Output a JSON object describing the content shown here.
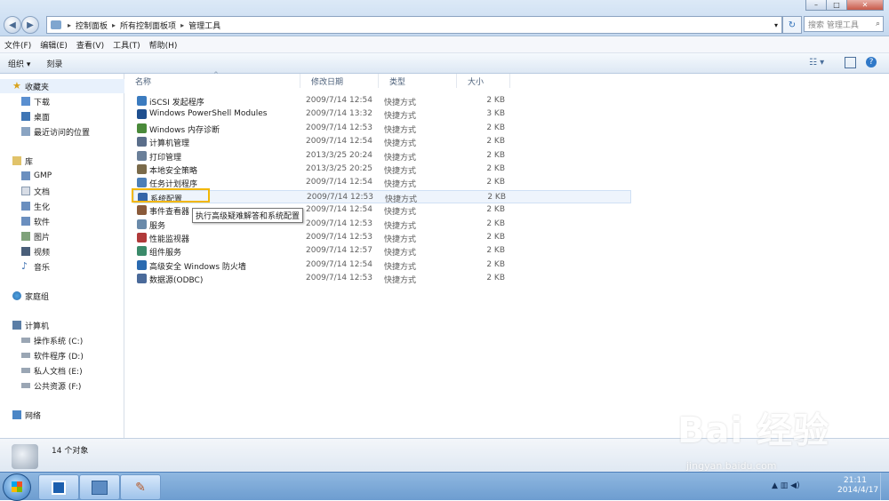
{
  "address": {
    "crumbs": [
      "控制面板",
      "所有控制面板项",
      "管理工具"
    ],
    "search_placeholder": "搜索 管理工具"
  },
  "menu": [
    "文件(F)",
    "编辑(E)",
    "查看(V)",
    "工具(T)",
    "帮助(H)"
  ],
  "toolbar": {
    "organize": "组织 ▾",
    "burn": "刻录"
  },
  "nav": {
    "favorites": {
      "label": "收藏夹",
      "items": [
        "下载",
        "桌面",
        "最近访问的位置"
      ]
    },
    "libraries": {
      "label": "库",
      "items": [
        "GMP",
        "文档",
        "生化",
        "软件",
        "图片",
        "视频",
        "音乐"
      ]
    },
    "homegroup": "家庭组",
    "computer": {
      "label": "计算机",
      "items": [
        "操作系统 (C:)",
        "软件程序 (D:)",
        "私人文档 (E:)",
        "公共资源 (F:)"
      ]
    },
    "network": "网络"
  },
  "columns": {
    "name": "名称",
    "date": "修改日期",
    "type": "类型",
    "size": "大小"
  },
  "files": [
    {
      "name": "iSCSI 发起程序",
      "date": "2009/7/14 12:54",
      "type": "快捷方式",
      "size": "2 KB",
      "color": "#3b7bbf"
    },
    {
      "name": "Windows PowerShell Modules",
      "date": "2009/7/14 13:32",
      "type": "快捷方式",
      "size": "3 KB",
      "color": "#1f4f8f"
    },
    {
      "name": "Windows 内存诊断",
      "date": "2009/7/14 12:53",
      "type": "快捷方式",
      "size": "2 KB",
      "color": "#4a8a3a"
    },
    {
      "name": "计算机管理",
      "date": "2009/7/14 12:54",
      "type": "快捷方式",
      "size": "2 KB",
      "color": "#5a6e8a"
    },
    {
      "name": "打印管理",
      "date": "2013/3/25 20:24",
      "type": "快捷方式",
      "size": "2 KB",
      "color": "#6a7f99"
    },
    {
      "name": "本地安全策略",
      "date": "2013/3/25 20:25",
      "type": "快捷方式",
      "size": "2 KB",
      "color": "#7a6a4a"
    },
    {
      "name": "任务计划程序",
      "date": "2009/7/14 12:54",
      "type": "快捷方式",
      "size": "2 KB",
      "color": "#4d7fb8"
    },
    {
      "name": "系统配置",
      "date": "2009/7/14 12:53",
      "type": "快捷方式",
      "size": "2 KB",
      "color": "#3565a8"
    },
    {
      "name": "事件查看器",
      "date": "2009/7/14 12:54",
      "type": "快捷方式",
      "size": "2 KB",
      "color": "#8a5a3a"
    },
    {
      "name": "服务",
      "date": "2009/7/14 12:53",
      "type": "快捷方式",
      "size": "2 KB",
      "color": "#6a8aaa"
    },
    {
      "name": "性能监视器",
      "date": "2009/7/14 12:53",
      "type": "快捷方式",
      "size": "2 KB",
      "color": "#b03a3a"
    },
    {
      "name": "组件服务",
      "date": "2009/7/14 12:57",
      "type": "快捷方式",
      "size": "2 KB",
      "color": "#3a8a6a"
    },
    {
      "name": "高级安全 Windows 防火墙",
      "date": "2009/7/14 12:54",
      "type": "快捷方式",
      "size": "2 KB",
      "color": "#2a6ab0"
    },
    {
      "name": "数据源(ODBC)",
      "date": "2009/7/14 12:53",
      "type": "快捷方式",
      "size": "2 KB",
      "color": "#4a6a9a"
    }
  ],
  "tooltip": "执行高级疑难解答和系统配置",
  "status": {
    "count": "14 个对象"
  },
  "clock": {
    "time": "21:11",
    "date": "2014/4/17"
  },
  "watermark": {
    "text": "Bai 经验",
    "url": "jingyan.baidu.com"
  }
}
